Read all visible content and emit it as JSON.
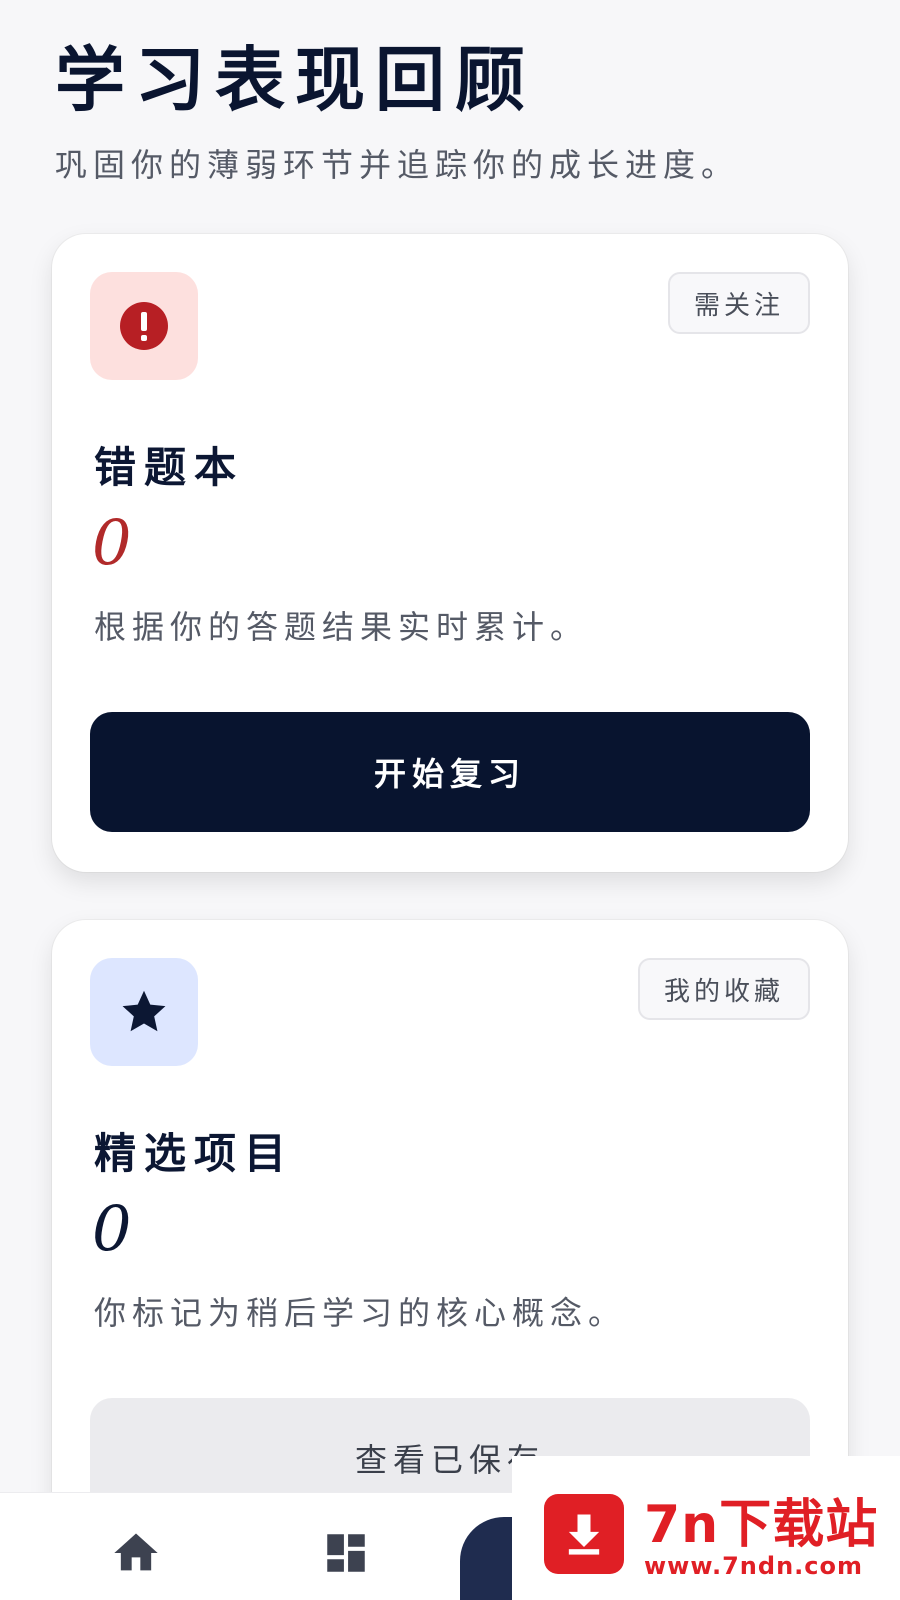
{
  "header": {
    "title": "学习表现回顾",
    "subtitle": "巩固你的薄弱环节并追踪你的成长进度。"
  },
  "cards": [
    {
      "icon": "alert-circle-icon",
      "tag": "需关注",
      "title": "错题本",
      "count": "0",
      "description": "根据你的答题结果实时累计。",
      "button_label": "开始复习",
      "accent_color": "#b12a2a"
    },
    {
      "icon": "star-icon",
      "tag": "我的收藏",
      "title": "精选项目",
      "count": "0",
      "description": "你标记为稍后学习的核心概念。",
      "button_label": "查看已保存",
      "accent_color": "#0c1733"
    }
  ],
  "bottom_nav": {
    "items": [
      {
        "icon": "home-icon"
      },
      {
        "icon": "dashboard-icon"
      },
      {
        "icon": "active-tab"
      }
    ]
  },
  "watermark": {
    "name": "7n下载站",
    "url": "www.7ndn.com",
    "color": "#e01f25"
  }
}
